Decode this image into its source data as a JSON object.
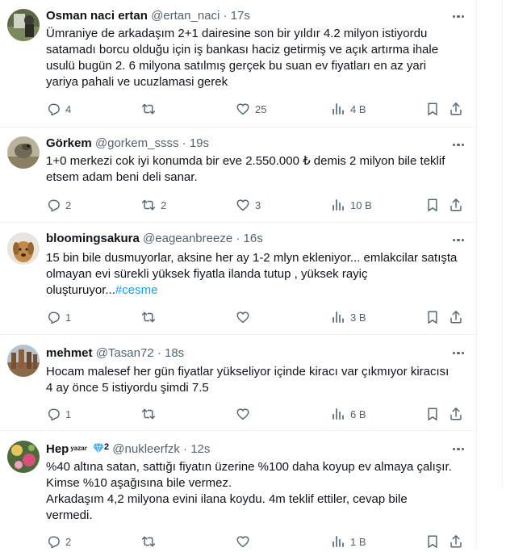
{
  "tweets": [
    {
      "name": "Osman naci ertan",
      "handle": "@ertan_naci",
      "time": "17s",
      "text": "Ümraniye de arkadaşım 2+1 dairesine son bir yıldır 4.2 milyon istiyordu\nsatamadı borcu olduğu için iş bankası haciz getirmiş ve açık artırma ihale\nusulü bugün 2. 6 milyona satılmış gerçek bu suan ev fiyatları en az yari\nyariya pahali ve ucuzlamasi gerek",
      "hashtag": "",
      "replies": "4",
      "retweets": "",
      "likes": "25",
      "views": "4 B"
    },
    {
      "name": "Görkem",
      "handle": "@gorkem_ssss",
      "time": "19s",
      "text": "1+0 merkezi cok iyi konumda bir eve 2.550.000 ₺ demis 2 milyon bile teklif\netsem adam beni deli sanar.",
      "hashtag": "",
      "replies": "2",
      "retweets": "2",
      "likes": "3",
      "views": "10 B"
    },
    {
      "name": "bloomingsakura",
      "handle": "@eageanbreeze",
      "time": "16s",
      "text": "15 bin bile dusmuyorlar, aksine her ay 1-2 mlyn ekleniyor... emlakcilar satışta\nolmayan evi sürekli yüksek fiyatla ilanda tutup , yüksek rayiç\noluşturuyor...",
      "hashtag": "#cesme",
      "replies": "1",
      "retweets": "",
      "likes": "",
      "views": "3 B"
    },
    {
      "name": "mehmet",
      "handle": "@Tasan72",
      "time": "18s",
      "text": "Hocam malesef her gün fiyatlar yükseliyor içinde kiracı var çıkmıyor kiracısı\n4 ay önce 5 istiyordu şimdi 7.5",
      "hashtag": "",
      "replies": "1",
      "retweets": "",
      "likes": "",
      "views": "6 B"
    },
    {
      "name": "Hep",
      "badge": "yazar",
      "badge_number": "2",
      "handle": "@nukleerfzk",
      "time": "12s",
      "text": "%40 altına satan, sattığı fiyatın üzerine %100 daha koyup ev almaya çalışır.\nKimse %10 aşağısına bile vermez.\nArkadaşım 4,2 milyona evini ilana koydu. 4m teklif ettiler, cevap bile\nvermedi.",
      "hashtag": "",
      "replies": "2",
      "retweets": "",
      "likes": "",
      "views": "1 B"
    }
  ],
  "separator": "·",
  "colors": {
    "text": "#0f1419",
    "secondary": "#536471",
    "link": "#1d9bf0",
    "divider": "#eff3f4"
  },
  "icons": [
    "reply-icon",
    "retweet-icon",
    "like-icon",
    "views-icon",
    "bookmark-icon",
    "share-icon",
    "more-icon",
    "diamond-icon"
  ]
}
